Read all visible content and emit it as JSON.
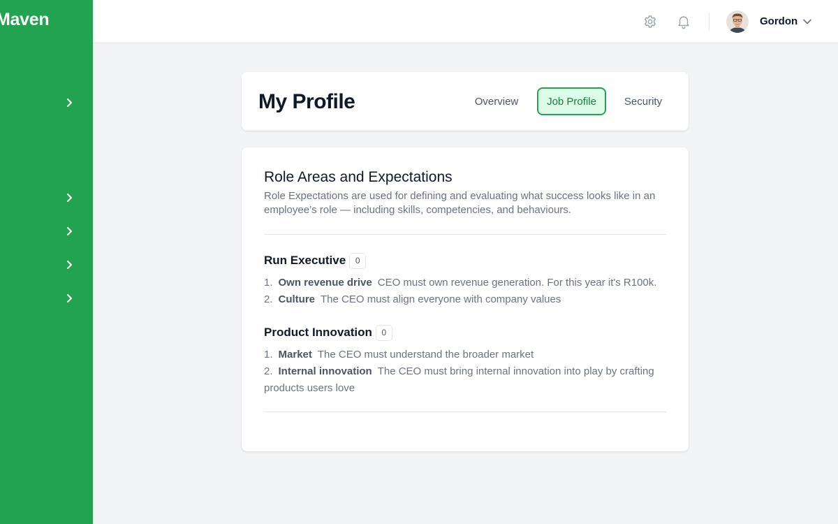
{
  "app": {
    "brand": "Maven"
  },
  "topbar": {
    "user_name": "Gordon",
    "settings_icon": "gear-icon",
    "notifications_icon": "bell-icon"
  },
  "header": {
    "title": "My Profile",
    "tabs": [
      {
        "label": "Overview",
        "active": false
      },
      {
        "label": "Job Profile",
        "active": true
      },
      {
        "label": "Security",
        "active": false
      }
    ]
  },
  "role_areas": {
    "title": "Role Areas and Expectations",
    "description": "Role Expectations are used for defining and evaluating what success looks like in an employee’s role — including skills, competencies, and behaviours.",
    "groups": [
      {
        "name": "Run Executive",
        "count": "0",
        "items": [
          {
            "num": "1.",
            "name": "Own revenue drive",
            "desc": "CEO must own revenue generation. For this year it's R100k."
          },
          {
            "num": "2.",
            "name": "Culture",
            "desc": "The CEO must align everyone with company values"
          }
        ]
      },
      {
        "name": "Product Innovation",
        "count": "0",
        "items": [
          {
            "num": "1.",
            "name": "Market",
            "desc": "The CEO must understand the broader market"
          },
          {
            "num": "2.",
            "name": "Internal innovation",
            "desc": "The CEO must bring internal innovation into play by crafting products users love"
          }
        ]
      }
    ]
  },
  "colors": {
    "brand_green": "#22a34f",
    "active_tab_bg": "#dcfce7",
    "active_tab_text": "#15803d"
  }
}
